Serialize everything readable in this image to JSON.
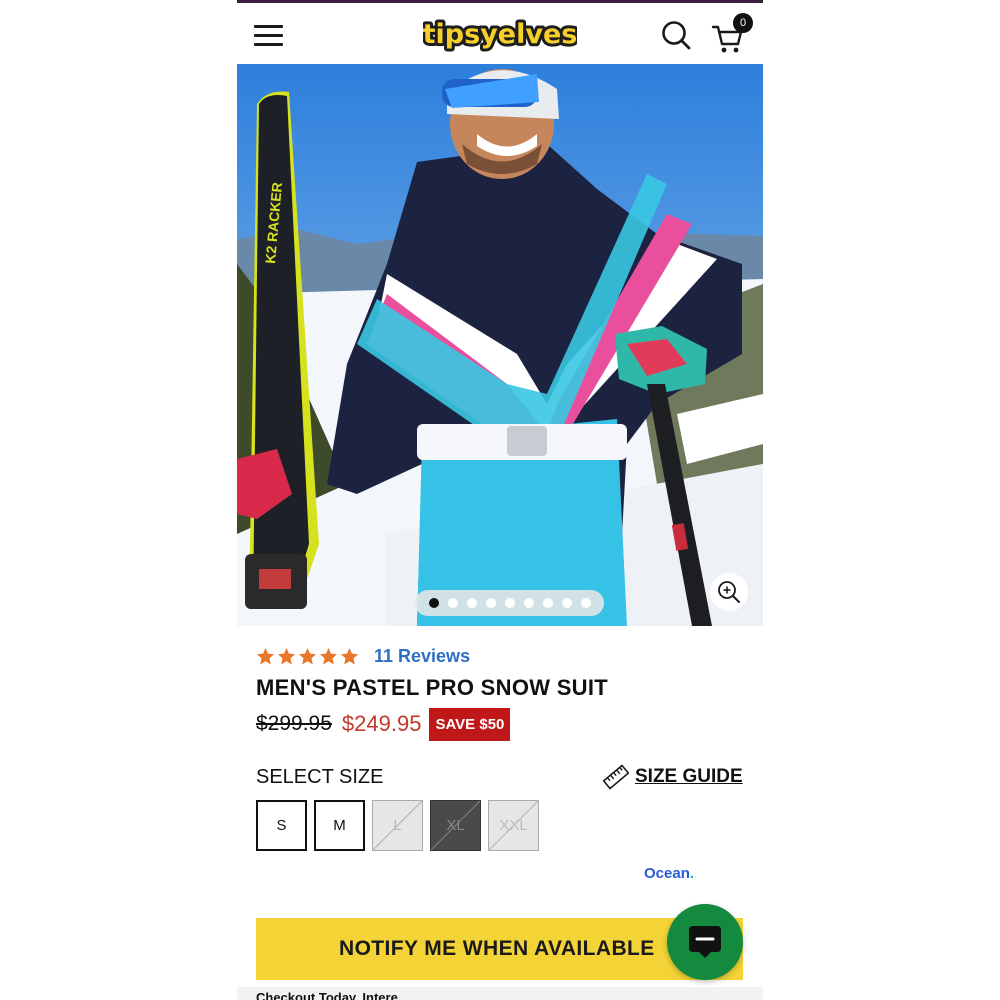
{
  "header": {
    "logo_text": "tipsyelves",
    "cart_count": "0"
  },
  "gallery": {
    "total_images": 9,
    "active_index": 0
  },
  "product": {
    "rating": 5,
    "reviews_label": "11 Reviews",
    "title": "MEN'S PASTEL PRO SNOW SUIT",
    "original_price": "$299.95",
    "sale_price": "$249.95",
    "save_badge": "SAVE $50"
  },
  "size_selector": {
    "label": "SELECT SIZE",
    "size_guide_label": "SIZE GUIDE",
    "sizes": [
      {
        "label": "S",
        "available": true
      },
      {
        "label": "M",
        "available": true
      },
      {
        "label": "L",
        "available": false
      },
      {
        "label": "XL",
        "available": false,
        "selected": true
      },
      {
        "label": "XXL",
        "available": false
      }
    ]
  },
  "ocean_badge": "Ocean",
  "notify_button_label": "NOTIFY ME WHEN AVAILABLE",
  "bottom_text": "Checkout Today, Intere...",
  "colors": {
    "accent_yellow": "#f3d335",
    "sale_red": "#c0392b",
    "badge_red": "#c01818",
    "star_orange": "#e8762b",
    "link_blue": "#2e6fc4",
    "chat_green": "#148a3e"
  }
}
